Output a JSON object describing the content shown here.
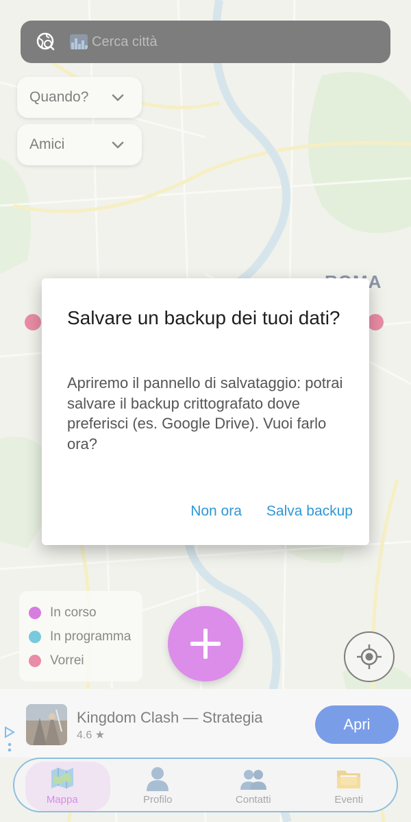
{
  "search": {
    "placeholder": "Cerca città",
    "globe_icon": "globe-search-icon",
    "city_icon": "cityscape-icon"
  },
  "filters": [
    {
      "label": "Quando?",
      "icon": "chevron-down-icon"
    },
    {
      "label": "Amici",
      "icon": "chevron-down-icon"
    }
  ],
  "map": {
    "city_label": "ROMA"
  },
  "legend": {
    "items": [
      {
        "label": "In corso",
        "color": "#b81fc7"
      },
      {
        "label": "In programma",
        "color": "#16a3c2"
      },
      {
        "label": "Vorrei",
        "color": "#d93a66"
      }
    ]
  },
  "fab": {
    "icon": "plus-icon",
    "color": "#c23bd9"
  },
  "locate": {
    "icon": "crosshair-icon"
  },
  "ad": {
    "app_name": "Kingdom Clash — Strategia",
    "rating": "4.6 ★",
    "open_label": "Apri",
    "button_color": "#1a57d6"
  },
  "nav": {
    "items": [
      {
        "label": "Mappa",
        "icon": "map-icon",
        "active": true
      },
      {
        "label": "Profilo",
        "icon": "person-icon",
        "active": false
      },
      {
        "label": "Contatti",
        "icon": "contacts-icon",
        "active": false
      },
      {
        "label": "Eventi",
        "icon": "folder-icon",
        "active": false
      }
    ],
    "active_color": "#b23fc9",
    "border_color": "#3a8fc9"
  },
  "dialog": {
    "title": "Salvare un backup dei tuoi dati?",
    "body": "Apriremo il pannello di salvataggio: potrai salvare il backup crittografato dove preferisci (es. Google Drive). Vuoi farlo ora?",
    "cancel_label": "Non ora",
    "confirm_label": "Salva backup",
    "accent": "#2f97d6"
  }
}
